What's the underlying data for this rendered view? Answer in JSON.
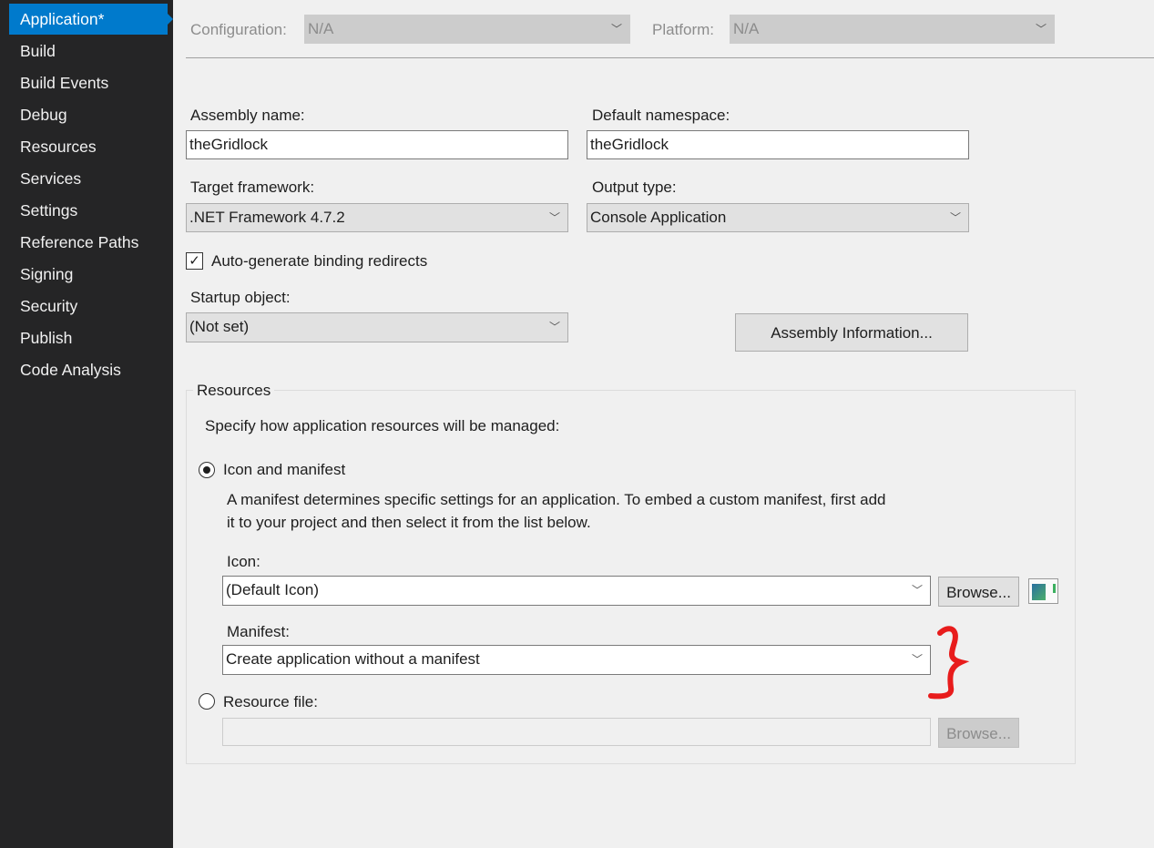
{
  "sidebar": {
    "items": [
      {
        "label": "Application*",
        "selected": true
      },
      {
        "label": "Build"
      },
      {
        "label": "Build Events"
      },
      {
        "label": "Debug"
      },
      {
        "label": "Resources"
      },
      {
        "label": "Services"
      },
      {
        "label": "Settings"
      },
      {
        "label": "Reference Paths"
      },
      {
        "label": "Signing"
      },
      {
        "label": "Security"
      },
      {
        "label": "Publish"
      },
      {
        "label": "Code Analysis"
      }
    ]
  },
  "toolbar": {
    "configuration_label": "Configuration:",
    "configuration_value": "N/A",
    "platform_label": "Platform:",
    "platform_value": "N/A"
  },
  "form": {
    "assembly_name_label": "Assembly name:",
    "assembly_name": "theGridlock",
    "default_namespace_label": "Default namespace:",
    "default_namespace": "theGridlock",
    "target_framework_label": "Target framework:",
    "target_framework": ".NET Framework 4.7.2",
    "output_type_label": "Output type:",
    "output_type": "Console Application",
    "auto_binding_label": "Auto-generate binding redirects",
    "auto_binding_checked": true,
    "startup_object_label": "Startup object:",
    "startup_object": "(Not set)",
    "assembly_info_button": "Assembly Information..."
  },
  "resources": {
    "group_title": "Resources",
    "description": "Specify how application resources will be managed:",
    "icon_manifest_label": "Icon and manifest",
    "manifest_help_line1": "A manifest determines specific settings for an application. To embed a custom manifest, first add",
    "manifest_help_line2": "it to your project and then select it from the list below.",
    "icon_label": "Icon:",
    "icon_value": "(Default Icon)",
    "browse_label": "Browse...",
    "manifest_label": "Manifest:",
    "manifest_value": "Create application without a manifest",
    "resource_file_label": "Resource file:",
    "resource_file_value": "",
    "resource_browse_label": "Browse...",
    "selected_option": "Icon and manifest"
  },
  "annotation_color": "#e81c1c"
}
